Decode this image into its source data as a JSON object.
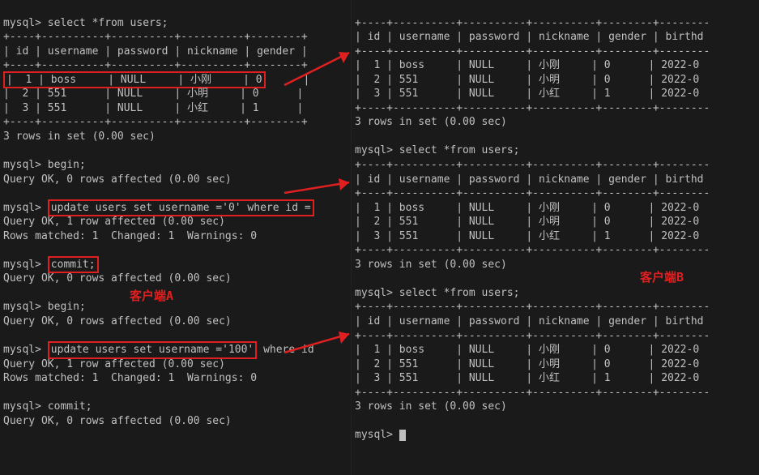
{
  "left": {
    "prompt": "mysql>",
    "query_select": " select *from users;",
    "header_sep": "+----+----------+----------+----------+--------+",
    "header_row": "| id | username | password | nickname | gender |",
    "row1_hl": "|  1 | boss     | NULL     | 小刚     | 0",
    "row1_rest": "      |",
    "row2": "|  2 | 551      | NULL     | 小明     | 0      |",
    "row3": "|  3 | 551      | NULL     | 小红     | 1      |",
    "set_msg": "3 rows in set (0.00 sec)",
    "begin_cmd": "mysql> begin;",
    "ok_msg": "Query OK, 0 rows affected (0.00 sec)",
    "update1_pre": "mysql> ",
    "update1_hl": "update users set username ='0' where id =",
    "ok1": "Query OK, 1 row affected (0.00 sec)",
    "matched": "Rows matched: 1  Changed: 1  Warnings: 0",
    "commit_pre": "mysql> ",
    "commit_hl": "commit;",
    "label_a": "客户端A",
    "update2_pre": "mysql> ",
    "update2_hl": "update users set username ='100'",
    "update2_rest": " where id"
  },
  "right": {
    "prompt": "mysql>",
    "header_sep": "+----+----------+----------+----------+--------+--------",
    "header_row": "| id | username | password | nickname | gender | birthd",
    "row1": "|  1 | boss     | NULL     | 小刚     | 0      | 2022-0",
    "row2": "|  2 | 551      | NULL     | 小明     | 0      | 2022-0",
    "row3": "|  3 | 551      | NULL     | 小红     | 1      | 2022-0",
    "set_msg": "3 rows in set (0.00 sec)",
    "query_select": " select *from users;",
    "label_b": "客户端B"
  }
}
